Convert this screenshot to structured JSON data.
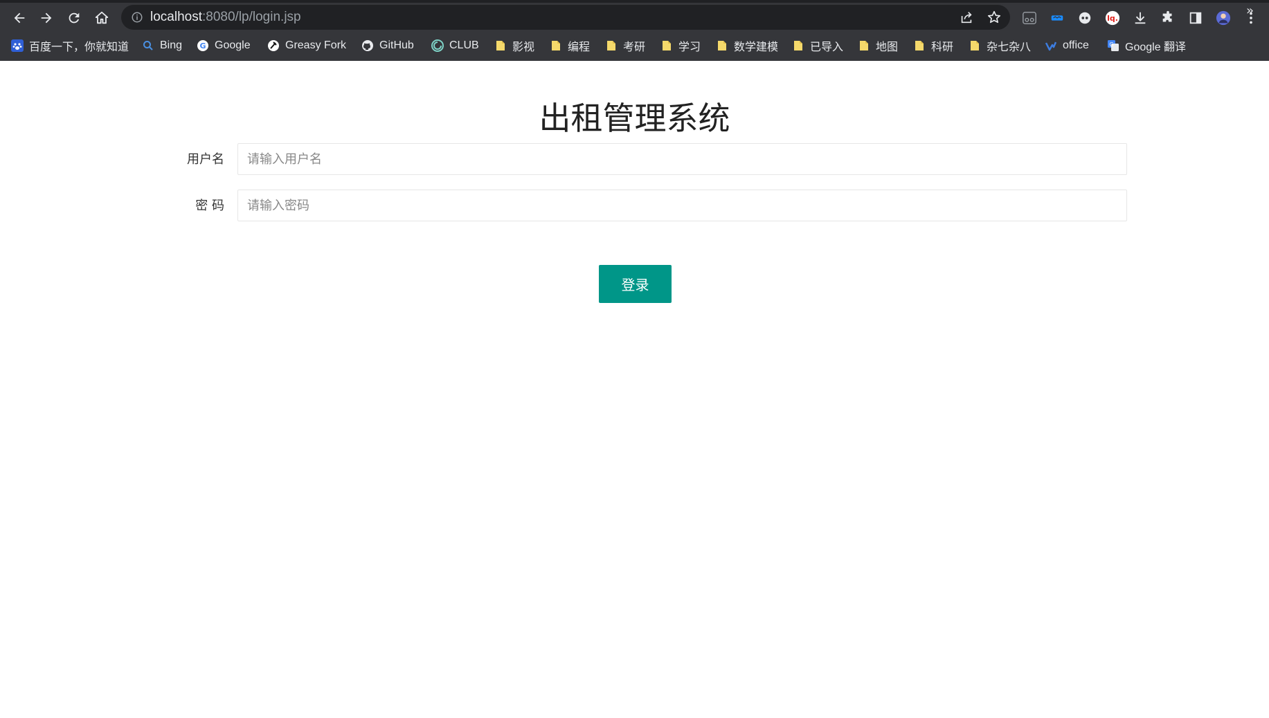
{
  "browser": {
    "url_host": "localhost",
    "url_rest": ":8080/lp/login.jsp",
    "bookmarks": [
      {
        "label": "百度一下，你就知道",
        "icon": "baidu-icon"
      },
      {
        "label": "Bing",
        "icon": "bing-search-icon"
      },
      {
        "label": "Google",
        "icon": "google-icon"
      },
      {
        "label": "Greasy Fork",
        "icon": "greasyfork-icon"
      },
      {
        "label": "GitHub",
        "icon": "github-icon"
      },
      {
        "label": "CLUB",
        "icon": "club-icon"
      },
      {
        "label": "影视",
        "icon": "folder-icon"
      },
      {
        "label": "编程",
        "icon": "folder-icon"
      },
      {
        "label": "考研",
        "icon": "folder-icon"
      },
      {
        "label": "学习",
        "icon": "folder-icon"
      },
      {
        "label": "数学建模",
        "icon": "folder-icon"
      },
      {
        "label": "已导入",
        "icon": "folder-icon"
      },
      {
        "label": "地图",
        "icon": "folder-icon"
      },
      {
        "label": "科研",
        "icon": "folder-icon"
      },
      {
        "label": "杂七杂八",
        "icon": "folder-icon"
      },
      {
        "label": "office",
        "icon": "office-icon"
      },
      {
        "label": "Google 翻译",
        "icon": "google-translate-icon"
      }
    ],
    "more_bookmarks": "»"
  },
  "page": {
    "title": "出租管理系统",
    "username_label": "用户名",
    "username_placeholder": "请输入用户名",
    "username_value": "",
    "password_label": "密 码",
    "password_placeholder": "请输入密码",
    "password_value": "",
    "login_button": "登录"
  },
  "colors": {
    "chrome_bg": "#35363a",
    "omnibox_bg": "#202124",
    "button_accent": "#009688"
  }
}
